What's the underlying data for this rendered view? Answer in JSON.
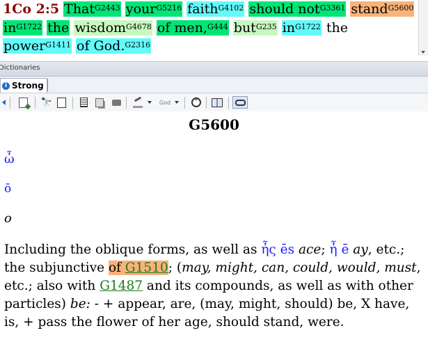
{
  "verse": {
    "reference": "1Co 2:5",
    "words": [
      {
        "text": "That",
        "strong": "G2443",
        "hl": "green"
      },
      {
        "text": "your",
        "strong": "G5216",
        "hl": "green"
      },
      {
        "text": "faith",
        "strong": "G4102",
        "hl": "cyan"
      },
      {
        "text": "should not",
        "strong": "G3361",
        "hl": "green"
      },
      {
        "text": "stand",
        "strong": "G5600",
        "hl": "orange"
      },
      {
        "text": "in",
        "strong": "G1722",
        "hl": "green"
      },
      {
        "text": "the",
        "strong": "",
        "hl": "green"
      },
      {
        "text": "wisdom",
        "strong": "G4678",
        "hl": "light"
      },
      {
        "text": "of men,",
        "strong": "G444",
        "hl": "green"
      },
      {
        "text": "but",
        "strong": "G235",
        "hl": "light"
      },
      {
        "text": "in",
        "strong": "G1722",
        "hl": "cyan"
      },
      {
        "text": "the",
        "strong": "",
        "hl": "none"
      },
      {
        "text": "power",
        "strong": "G1411",
        "hl": "cyan"
      },
      {
        "text": "of God.",
        "strong": "G2316",
        "hl": "cyan"
      }
    ]
  },
  "dictionaries_header": "Dictionaries",
  "tabs": [
    {
      "label": "Strong"
    }
  ],
  "toolbar": {
    "god_label": "God"
  },
  "entry": {
    "title": "G5600",
    "greek": "ὦ",
    "transliteration": "ō",
    "pronunciation": "o",
    "definition": {
      "p1": "Including the oblique forms, as well as ",
      "g1": "ἦς",
      "t1": " ēs ",
      "w1": "ace",
      "p2": "; ",
      "g2": "ἦ",
      "t2": " ē ",
      "w2": "ay",
      "p3": ", etc.; the subjunctive ",
      "of": "of ",
      "link1": "G1510",
      "p4": "; (",
      "i1": "may, might, can, could, would, must",
      "p5": ", etc.; also with ",
      "link2": "G1487",
      "p6": " and its compounds, as well as with other particles) ",
      "i2": "be:",
      "p7": " - + appear, are, (may, might, should) be, X have, is, + pass the flower of her age, should stand, were."
    }
  }
}
